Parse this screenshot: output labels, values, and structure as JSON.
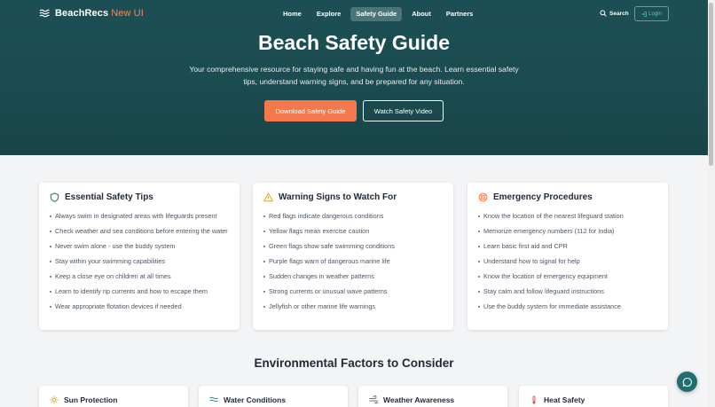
{
  "brand": {
    "name": "BeachRecs",
    "suffix": "New UI"
  },
  "nav": {
    "links": [
      {
        "label": "Home"
      },
      {
        "label": "Explore"
      },
      {
        "label": "Safety Guide"
      },
      {
        "label": "About"
      },
      {
        "label": "Partners"
      }
    ],
    "active": "Safety Guide",
    "search_label": "Search",
    "login_label": "Login"
  },
  "hero": {
    "title": "Beach Safety Guide",
    "subtitle": "Your comprehensive resource for staying safe and having fun at the beach. Learn essential safety tips, understand warning signs, and be prepared for any situation.",
    "primary_button": "Download Safety Guide",
    "secondary_button": "Watch Safety Video"
  },
  "cards": [
    {
      "title": "Essential Safety Tips",
      "icon": "shield-icon",
      "items": [
        "Always swim in designated areas with lifeguards present",
        "Check weather and sea conditions before entering the water",
        "Never swim alone - use the buddy system",
        "Stay within your swimming capabilities",
        "Keep a close eye on children at all times",
        "Learn to identify rip currents and how to escape them",
        "Wear appropriate flotation devices if needed"
      ]
    },
    {
      "title": "Warning Signs to Watch For",
      "icon": "warning-triangle-icon",
      "items": [
        "Red flags indicate dangerous conditions",
        "Yellow flags mean exercise caution",
        "Green flags show safe swimming conditions",
        "Purple flags warn of dangerous marine life",
        "Sudden changes in weather patterns",
        "Strong currents or unusual wave patterns",
        "Jellyfish or other marine life warnings"
      ]
    },
    {
      "title": "Emergency Procedures",
      "icon": "lifebuoy-icon",
      "items": [
        "Know the location of the nearest lifeguard station",
        "Memorize emergency numbers (112 for India)",
        "Learn basic first aid and CPR",
        "Understand how to signal for help",
        "Know the location of emergency equipment",
        "Stay calm and follow lifeguard instructions",
        "Use the buddy system for immediate assistance"
      ]
    }
  ],
  "environment": {
    "title": "Environmental Factors to Consider",
    "cards": [
      {
        "title": "Sun Protection",
        "icon": "sun-icon"
      },
      {
        "title": "Water Conditions",
        "icon": "waves-icon"
      },
      {
        "title": "Weather Awareness",
        "icon": "wind-icon"
      },
      {
        "title": "Heat Safety",
        "icon": "thermometer-icon"
      }
    ]
  },
  "colors": {
    "hero_bg": "#1b4d52",
    "accent_orange": "#f4784b",
    "accent_teal": "#2a7c7a",
    "page_bg": "#f3f4f6"
  }
}
